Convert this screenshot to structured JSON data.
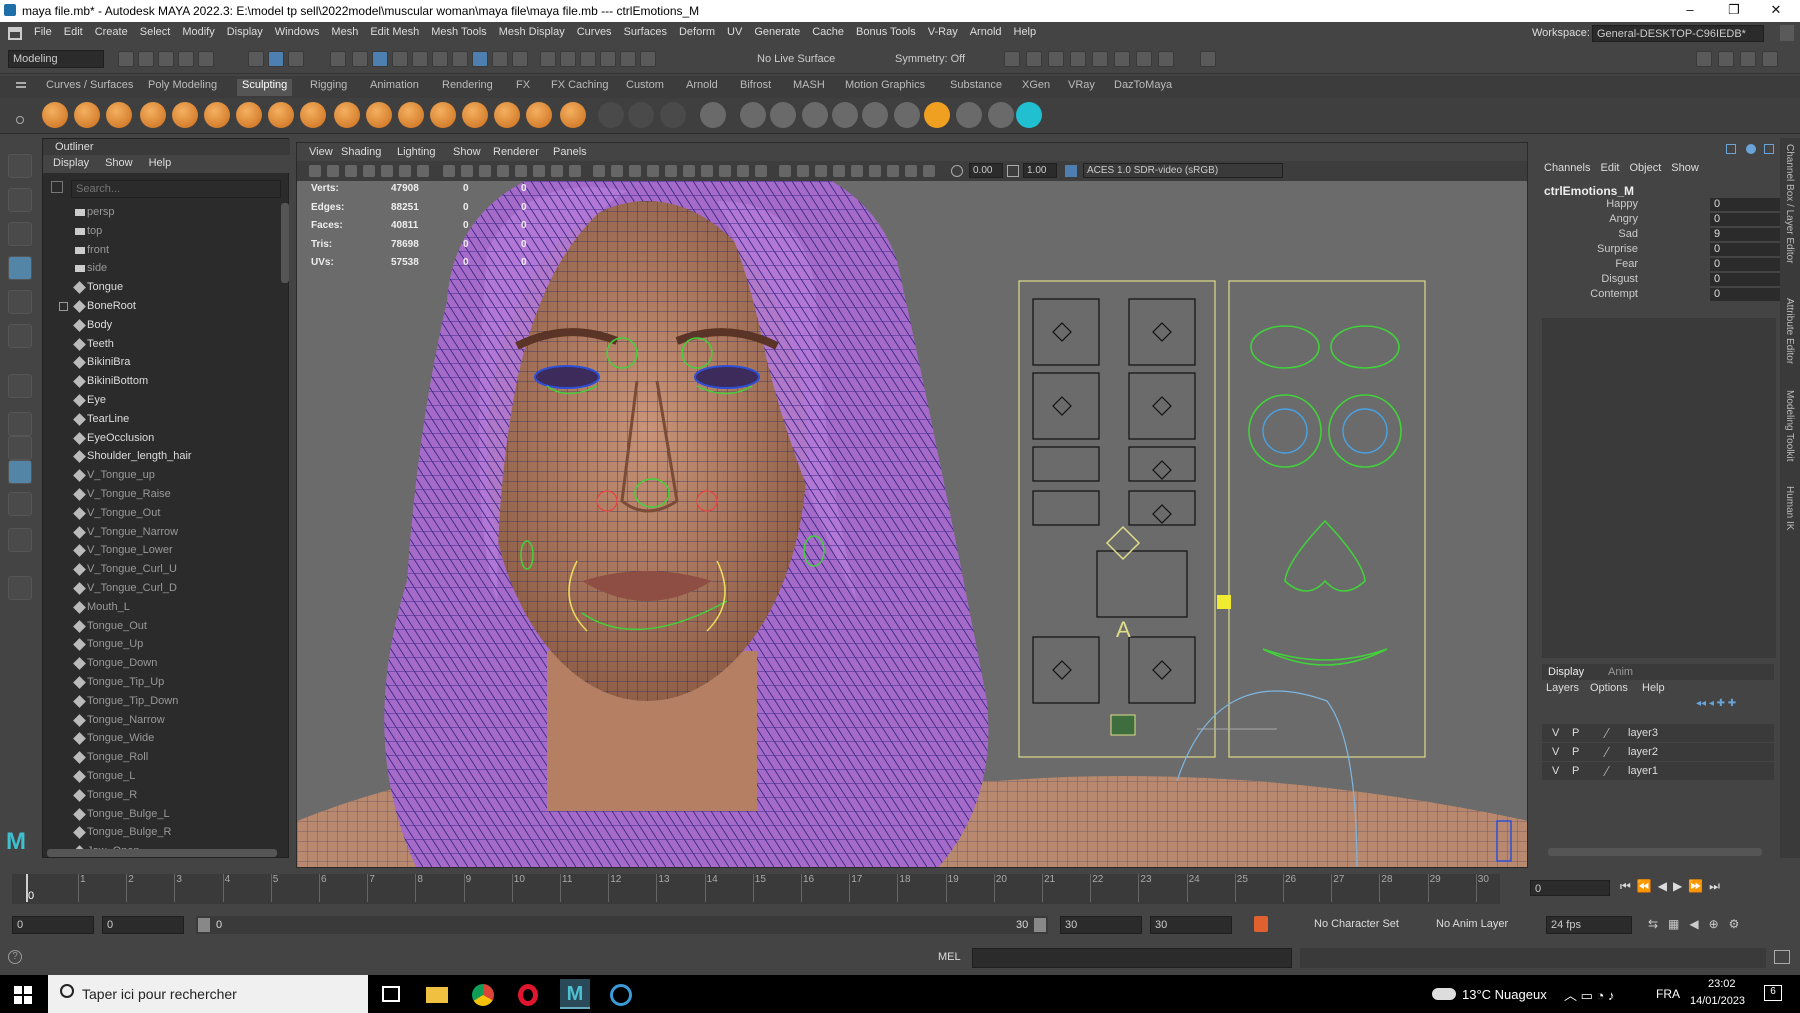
{
  "window": {
    "title": "maya file.mb* - Autodesk MAYA 2022.3: E:\\model tp sell\\2022model\\muscular woman\\maya file\\maya file.mb   ---   ctrlEmotions_M",
    "min": "–",
    "max": "❐",
    "close": "✕"
  },
  "menubar": [
    "File",
    "Edit",
    "Create",
    "Select",
    "Modify",
    "Display",
    "Windows",
    "Mesh",
    "Edit Mesh",
    "Mesh Tools",
    "Mesh Display",
    "Curves",
    "Surfaces",
    "Deform",
    "UV",
    "Generate",
    "Cache",
    "Bonus Tools",
    "V-Ray",
    "Arnold",
    "Help"
  ],
  "workspace": {
    "label": "Workspace:",
    "value": "General-DESKTOP-C96IEDB*"
  },
  "statusline": {
    "mode": "Modeling",
    "live_surface": "No Live Surface",
    "symmetry": "Symmetry: Off"
  },
  "shelf_tabs": [
    "Curves / Surfaces",
    "Poly Modeling",
    "Sculpting",
    "Rigging",
    "Animation",
    "Rendering",
    "FX",
    "FX Caching",
    "Custom",
    "Arnold",
    "Bifrost",
    "MASH",
    "Motion Graphics",
    "Substance",
    "XGen",
    "VRay",
    "DazToMaya"
  ],
  "shelf_active": "Sculpting",
  "outliner": {
    "title": "Outliner",
    "menu": [
      "Display",
      "Show",
      "Help"
    ],
    "search_placeholder": "Search...",
    "items": [
      {
        "label": "persp",
        "dim": true,
        "cam": true
      },
      {
        "label": "top",
        "dim": true,
        "cam": true
      },
      {
        "label": "front",
        "dim": true,
        "cam": true
      },
      {
        "label": "side",
        "dim": true,
        "cam": true
      },
      {
        "label": "Tongue",
        "dim": false
      },
      {
        "label": "BoneRoot",
        "dim": false,
        "expand": true
      },
      {
        "label": "Body",
        "dim": false
      },
      {
        "label": "Teeth",
        "dim": false
      },
      {
        "label": "BikiniBra",
        "dim": false
      },
      {
        "label": "BikiniBottom",
        "dim": false
      },
      {
        "label": "Eye",
        "dim": false
      },
      {
        "label": "TearLine",
        "dim": false
      },
      {
        "label": "EyeOcclusion",
        "dim": false
      },
      {
        "label": "Shoulder_length_hair",
        "dim": false
      },
      {
        "label": "V_Tongue_up",
        "dim": true
      },
      {
        "label": "V_Tongue_Raise",
        "dim": true
      },
      {
        "label": "V_Tongue_Out",
        "dim": true
      },
      {
        "label": "V_Tongue_Narrow",
        "dim": true
      },
      {
        "label": "V_Tongue_Lower",
        "dim": true
      },
      {
        "label": "V_Tongue_Curl_U",
        "dim": true
      },
      {
        "label": "V_Tongue_Curl_D",
        "dim": true
      },
      {
        "label": "Mouth_L",
        "dim": true
      },
      {
        "label": "Tongue_Out",
        "dim": true
      },
      {
        "label": "Tongue_Up",
        "dim": true
      },
      {
        "label": "Tongue_Down",
        "dim": true
      },
      {
        "label": "Tongue_Tip_Up",
        "dim": true
      },
      {
        "label": "Tongue_Tip_Down",
        "dim": true
      },
      {
        "label": "Tongue_Narrow",
        "dim": true
      },
      {
        "label": "Tongue_Wide",
        "dim": true
      },
      {
        "label": "Tongue_Roll",
        "dim": true
      },
      {
        "label": "Tongue_L",
        "dim": true
      },
      {
        "label": "Tongue_R",
        "dim": true
      },
      {
        "label": "Tongue_Bulge_L",
        "dim": true
      },
      {
        "label": "Tongue_Bulge_R",
        "dim": true
      },
      {
        "label": "Jaw_Open",
        "dim": true
      }
    ]
  },
  "viewport": {
    "menu": [
      "View",
      "Shading",
      "Lighting",
      "Show",
      "Renderer",
      "Panels"
    ],
    "exposure": "0.00",
    "gamma": "1.00",
    "color_space": "ACES 1.0 SDR-video (sRGB)",
    "hud": [
      {
        "label": "Verts:",
        "value": "47908",
        "z1": "0",
        "z2": "0"
      },
      {
        "label": "Edges:",
        "value": "88251",
        "z1": "0",
        "z2": "0"
      },
      {
        "label": "Faces:",
        "value": "40811",
        "z1": "0",
        "z2": "0"
      },
      {
        "label": "Tris:",
        "value": "78698",
        "z1": "0",
        "z2": "0"
      },
      {
        "label": "UVs:",
        "value": "57538",
        "z1": "0",
        "z2": "0"
      }
    ],
    "ctrl_letter": "A"
  },
  "channelbox": {
    "menu": [
      "Channels",
      "Edit",
      "Object",
      "Show"
    ],
    "node": "ctrlEmotions_M",
    "attrs": [
      {
        "name": "Happy",
        "value": "0"
      },
      {
        "name": "Angry",
        "value": "0"
      },
      {
        "name": "Sad",
        "value": "9"
      },
      {
        "name": "Surprise",
        "value": "0"
      },
      {
        "name": "Fear",
        "value": "0"
      },
      {
        "name": "Disgust",
        "value": "0"
      },
      {
        "name": "Contempt",
        "value": "0"
      }
    ]
  },
  "layers": {
    "tabs": [
      "Display",
      "Anim"
    ],
    "menu": [
      "Layers",
      "Options",
      "Help"
    ],
    "rows": [
      {
        "v": "V",
        "p": "P",
        "name": "layer3"
      },
      {
        "v": "V",
        "p": "P",
        "name": "layer2"
      },
      {
        "v": "V",
        "p": "P",
        "name": "layer1"
      }
    ]
  },
  "side_tabs": [
    "Channel Box / Layer Editor",
    "Attribute Editor",
    "Modeling Toolkit",
    "Human IK"
  ],
  "timeline": {
    "ticks": [
      "1",
      "2",
      "3",
      "4",
      "5",
      "6",
      "7",
      "8",
      "9",
      "10",
      "11",
      "12",
      "13",
      "14",
      "15",
      "16",
      "17",
      "18",
      "19",
      "20",
      "21",
      "22",
      "23",
      "24",
      "25",
      "26",
      "27",
      "28",
      "29",
      "30"
    ],
    "current_frame_marker": "0",
    "current_frame": "0"
  },
  "range": {
    "start": "0",
    "anim_start": "0",
    "range_start": "0",
    "range_end": "30",
    "end": "30",
    "anim_end": "30",
    "character_set": "No Character Set",
    "anim_layer": "No Anim Layer",
    "fps": "24 fps"
  },
  "cmdline": {
    "label": "MEL"
  },
  "taskbar": {
    "search": "Taper ici pour rechercher",
    "weather": "13°C  Nuageux",
    "lang": "FRA",
    "time": "23:02",
    "date": "14/01/2023",
    "notif": "6"
  }
}
